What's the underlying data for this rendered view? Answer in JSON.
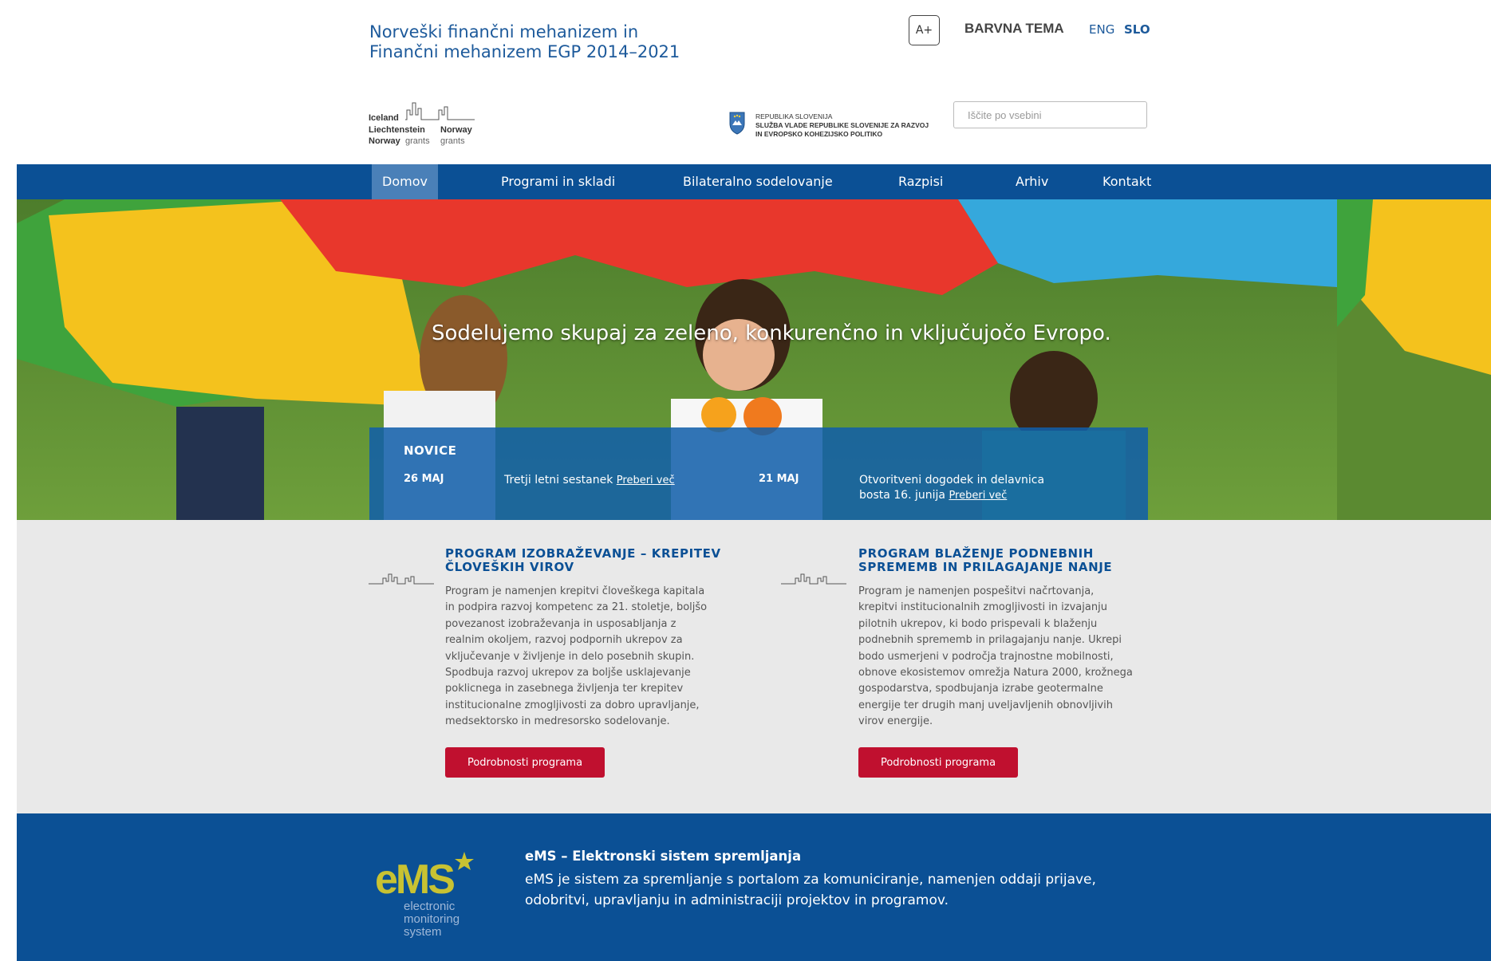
{
  "header": {
    "site_title_line1": "Norveški finančni mehanizem in",
    "site_title_line2": "Finančni mehanizem EGP 2014–2021",
    "font_size_button": "A+",
    "theme_label": "BARVNA TEMA",
    "lang_eng": "ENG",
    "lang_slo": "SLO",
    "search_placeholder": "Iščite po vsebini"
  },
  "logos": {
    "grants": {
      "iceland": "Iceland",
      "liechtenstein": "Liechtenstein",
      "norway": "Norway",
      "norway_right": "Norway",
      "grants": "grants"
    },
    "government": {
      "line1": "REPUBLIKA SLOVENIJA",
      "line2": "SLUŽBA VLADE REPUBLIKE SLOVENIJE ZA RAZVOJ",
      "line3": "IN EVROPSKO KOHEZIJSKO POLITIKO"
    }
  },
  "nav": {
    "items": [
      {
        "label": "Domov",
        "active": true
      },
      {
        "label": "Programi in skladi",
        "active": false
      },
      {
        "label": "Bilateralno sodelovanje",
        "active": false
      },
      {
        "label": "Razpisi",
        "active": false
      },
      {
        "label": "Arhiv",
        "active": false
      },
      {
        "label": "Kontakt",
        "active": false
      }
    ]
  },
  "hero": {
    "slogan": "Sodelujemo skupaj za zeleno, konkurenčno in vključujočo Evropo."
  },
  "news": {
    "title": "NOVICE",
    "items": [
      {
        "date": "26 MAJ",
        "text": "Tretji letni sestanek",
        "link": "Preberi več"
      },
      {
        "date": "21 MAJ",
        "text_line1": "Otvoritveni dogodek in delavnica",
        "text_line2": "bosta 16. junija",
        "link": "Preberi več"
      }
    ]
  },
  "programs": [
    {
      "title": "PROGRAM IZOBRAŽEVANJE – KREPITEV ČLOVEŠKIH VIROV",
      "body": "Program je namenjen krepitvi človeškega kapitala in podpira razvoj kompetenc za 21. stoletje, boljšo povezanost izobraževanja in usposabljanja z realnim okoljem, razvoj podpornih ukrepov za vključevanje v življenje in delo posebnih skupin. Spodbuja razvoj ukrepov za boljše usklajevanje poklicnega in zasebnega življenja ter krepitev institucionalne zmogljivosti za dobro upravljanje, medsektorsko in medresorsko sodelovanje.",
      "button": "Podrobnosti programa"
    },
    {
      "title": "PROGRAM BLAŽENJE PODNEBNIH SPREMEMB IN PRILAGAJANJE NANJE",
      "body": "Program je namenjen pospešitvi načrtovanja, krepitvi institucionalnih zmogljivosti in izvajanju pilotnih ukrepov, ki bodo prispevali k blaženju podnebnih sprememb in prilagajanju nanje. Ukrepi bodo usmerjeni v področja trajnostne mobilnosti, obnove ekosistemov omrežja Natura 2000, krožnega gospodarstva, spodbujanja izrabe geotermalne energije ter drugih manj uveljavljenih obnovljivih virov energije.",
      "button": "Podrobnosti programa"
    }
  ],
  "footer": {
    "ems_logo_main": "eMS",
    "ems_logo_line1": "electronic",
    "ems_logo_line2": "monitoring",
    "ems_logo_line3": "system",
    "ems_title": "eMS – Elektronski sistem spremljanja",
    "ems_text": "eMS je sistem za spremljanje s portalom za komuniciranje, namenjen oddaji prijave, odobritvi, upravljanju in administraciji projektov in programov."
  },
  "colors": {
    "brand_blue": "#0b5095",
    "nav_active": "#4a80b8",
    "button_red": "#c0102f",
    "section_gray": "#e9e9e9",
    "ems_logo_yellow": "#c8c232"
  }
}
